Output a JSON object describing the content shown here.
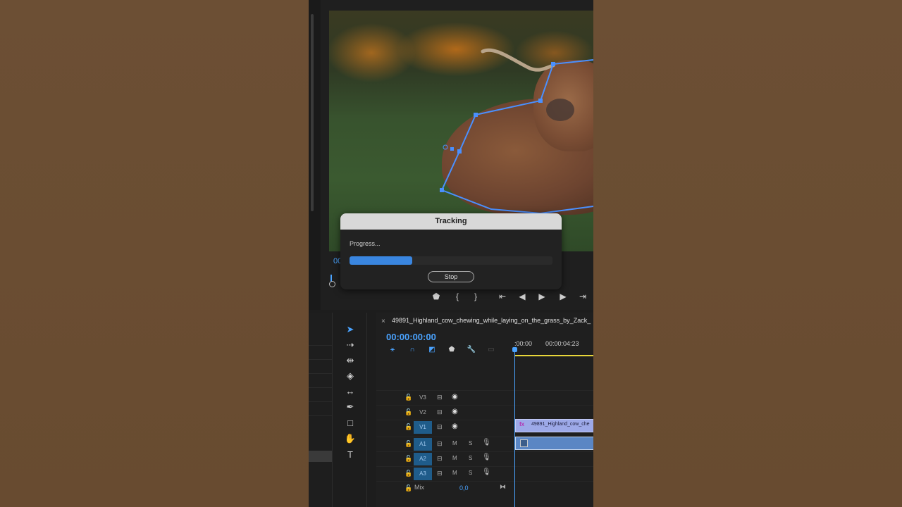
{
  "monitor": {
    "timecode_partial": "00",
    "transport_buttons": [
      "marker-icon",
      "in-bracket-icon",
      "out-bracket-icon",
      "go-to-in-icon",
      "step-back-icon",
      "play-icon",
      "step-forward-icon",
      "go-to-out-icon"
    ]
  },
  "tracking_dialog": {
    "title": "Tracking",
    "progress_label": "Progress...",
    "progress_fraction": 0.31,
    "stop_label": "Stop"
  },
  "tools": [
    "selection-icon",
    "track-select-icon",
    "ripple-edit-icon",
    "razor-icon",
    "slip-icon",
    "pen-icon",
    "rectangle-icon",
    "hand-icon",
    "type-icon"
  ],
  "timeline": {
    "title": "49891_Highland_cow_chewing_while_laying_on_the_grass_by_Zack_",
    "close": "×",
    "timecode": "00:00:00:00",
    "ruler": [
      ":00:00",
      "00:00:04:23"
    ],
    "tracks": {
      "video": [
        {
          "label": "V3"
        },
        {
          "label": "V2"
        },
        {
          "label": "V1"
        }
      ],
      "audio": [
        {
          "label": "A1",
          "m": "M",
          "s": "S"
        },
        {
          "label": "A2",
          "m": "M",
          "s": "S"
        },
        {
          "label": "A3",
          "m": "M",
          "s": "S"
        }
      ],
      "mix": {
        "label": "Mix",
        "value": "0,0"
      }
    },
    "clip_video_label": "49891_Highland_cow_che",
    "clip_video_fx": "fx"
  },
  "colors": {
    "accent": "#4aa3ff",
    "progress": "#3a86e0",
    "clip_video": "#9da9e8",
    "clip_audio": "#5a86c4",
    "track_selected": "#1f5c8a"
  }
}
